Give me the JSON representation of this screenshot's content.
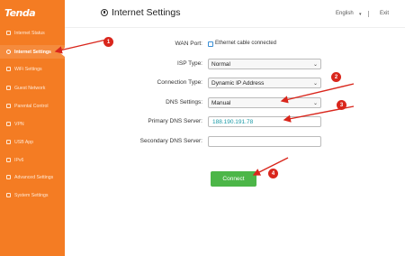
{
  "brand": {
    "logo": "Tenda"
  },
  "sidebar": {
    "items": [
      {
        "label": "Internet Status",
        "icon": "globe-icon"
      },
      {
        "label": "Internet Settings",
        "icon": "settings-circle-icon",
        "active": true
      },
      {
        "label": "WiFi Settings",
        "icon": "wifi-icon"
      },
      {
        "label": "Guest Network",
        "icon": "guest-icon"
      },
      {
        "label": "Parental Control",
        "icon": "parental-icon"
      },
      {
        "label": "VPN",
        "icon": "vpn-icon"
      },
      {
        "label": "USB App",
        "icon": "usb-icon"
      },
      {
        "label": "IPv6",
        "icon": "ipv6-icon"
      },
      {
        "label": "Advanced Settings",
        "icon": "advanced-icon"
      },
      {
        "label": "System Settings",
        "icon": "system-icon"
      }
    ]
  },
  "header": {
    "title": "Internet Settings",
    "language": "English",
    "exit": "Exit"
  },
  "form": {
    "wan_port": {
      "label": "WAN Port:",
      "status": "Ethernet cable connected"
    },
    "isp_type": {
      "label": "ISP Type:",
      "value": "Normal"
    },
    "connection_type": {
      "label": "Connection Type:",
      "value": "Dynamic IP Address"
    },
    "dns_settings": {
      "label": "DNS Settings:",
      "value": "Manual"
    },
    "primary_dns": {
      "label": "Primary DNS Server:",
      "value": "188.190.191.78"
    },
    "secondary_dns": {
      "label": "Secondary DNS Server:",
      "value": ""
    },
    "connect_label": "Connect"
  },
  "annotations": {
    "badges": [
      "1",
      "2",
      "3",
      "4"
    ],
    "color": "#d9261c"
  },
  "colors": {
    "sidebar": "#f47c23",
    "connect": "#4cb648",
    "dns_value": "#1a9aa6"
  }
}
